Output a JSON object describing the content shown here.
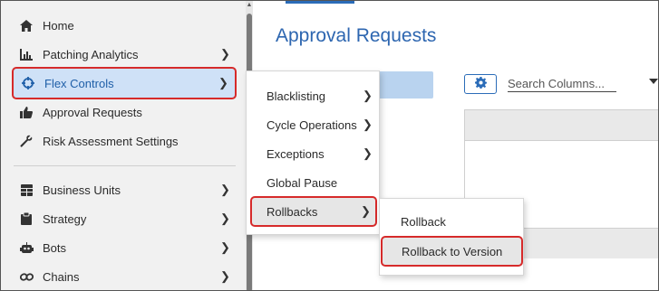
{
  "sidebar": {
    "items": [
      {
        "label": "Home",
        "icon": "home-icon",
        "chevron": false
      },
      {
        "label": "Patching Analytics",
        "icon": "analytics-icon",
        "chevron": true
      },
      {
        "label": "Flex Controls",
        "icon": "crosshair-icon",
        "chevron": true,
        "active": true
      },
      {
        "label": "Approval Requests",
        "icon": "thumbs-up-icon",
        "chevron": false
      },
      {
        "label": "Risk Assessment Settings",
        "icon": "wrench-icon",
        "chevron": false
      },
      {
        "label": "Business Units",
        "icon": "grid-icon",
        "chevron": true
      },
      {
        "label": "Strategy",
        "icon": "clipboard-icon",
        "chevron": true
      },
      {
        "label": "Bots",
        "icon": "bot-icon",
        "chevron": true
      },
      {
        "label": "Chains",
        "icon": "chain-icon",
        "chevron": true
      }
    ]
  },
  "main": {
    "title": "Approval Requests",
    "search": {
      "placeholder": "Search Columns..."
    }
  },
  "flyout": {
    "items": [
      {
        "label": "Blacklisting",
        "chevron": true
      },
      {
        "label": "Cycle Operations",
        "chevron": true
      },
      {
        "label": "Exceptions",
        "chevron": true
      },
      {
        "label": "Global Pause",
        "chevron": false
      },
      {
        "label": "Rollbacks",
        "chevron": true,
        "active": true
      }
    ]
  },
  "submenu": {
    "items": [
      {
        "label": "Rollback"
      },
      {
        "label": "Rollback to Version",
        "active": true
      }
    ]
  },
  "colors": {
    "accent": "#2d66b0",
    "highlight_border": "#d62a2a",
    "active_bg": "#cfe1f7"
  }
}
